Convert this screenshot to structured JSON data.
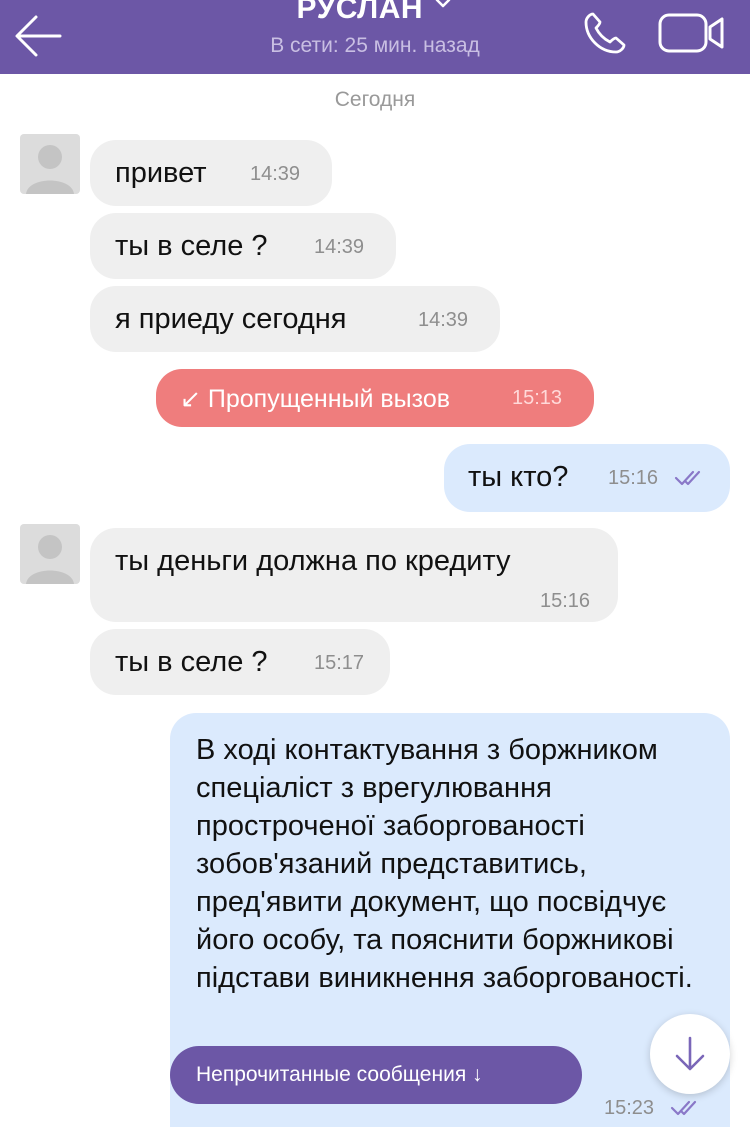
{
  "header": {
    "title": "РУСЛАН",
    "status": "В сети: 25 мин. назад",
    "icons": {
      "back": "arrow-left-icon",
      "dropdown": "chevron-down-icon",
      "call": "phone-icon",
      "video": "video-camera-icon"
    }
  },
  "chat": {
    "date_separator": "Сегодня",
    "messages": [
      {
        "direction": "in",
        "text": "привет",
        "time": "14:39"
      },
      {
        "direction": "in",
        "text": "ты в селе ?",
        "time": "14:39"
      },
      {
        "direction": "in",
        "text": "я приеду сегодня",
        "time": "14:39"
      },
      {
        "direction": "system",
        "text": "↙ Пропущенный вызов",
        "time": "15:13"
      },
      {
        "direction": "out",
        "text": "ты кто?",
        "time": "15:16",
        "status": "read"
      },
      {
        "direction": "in",
        "text": "ты деньги должна по кредиту",
        "time": "15:16"
      },
      {
        "direction": "in",
        "text": "ты в селе ?",
        "time": "15:17"
      },
      {
        "direction": "out",
        "text": "В ході контактування з боржником спеціаліст з врегулювання простроченої заборгованості зобов'язаний представитись, пред'явити документ, що посвідчує його особу, та пояснити боржникові підстави виникнення заборгованості.",
        "time": "15:23",
        "status": "read"
      }
    ]
  },
  "footer": {
    "unread_label": "Непрочитанные сообщения ↓",
    "scroll_down_icon": "arrow-down-icon"
  },
  "colors": {
    "header": "#6c57a6",
    "incoming_bubble": "#efefef",
    "outgoing_bubble": "#dbeafd",
    "missed_call": "#ef7d7d",
    "ticks": "#8a78c8"
  }
}
